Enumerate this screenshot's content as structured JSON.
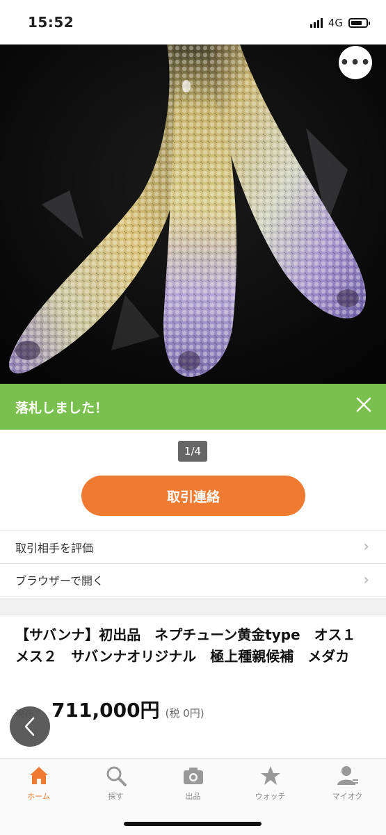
{
  "status": {
    "time": "15:52",
    "network": "4G",
    "battery_level": 0.75
  },
  "banner": {
    "text": "落札しました！"
  },
  "gallery": {
    "indicator": "1/4"
  },
  "contact_button": "取引連絡",
  "menu": [
    {
      "label": "取引相手を評価"
    },
    {
      "label": "ブラウザーで開く"
    }
  ],
  "listing": {
    "title": "【サバンナ】初出品　ネプチューン黄金type　オス１　メス２　サバンナオリジナル　極上種親候補　メダカ",
    "price_label": "現在",
    "price": "711,000円",
    "tax": "(税 0円)"
  },
  "tabs": [
    {
      "label": "ホーム",
      "icon": "home-icon",
      "active": true
    },
    {
      "label": "探す",
      "icon": "search-icon"
    },
    {
      "label": "出品",
      "icon": "camera-icon"
    },
    {
      "label": "ウォッチ",
      "icon": "star-icon"
    },
    {
      "label": "マイオク",
      "icon": "user-icon"
    }
  ],
  "colors": {
    "accent": "#ef7b33",
    "banner": "#7ac04f"
  }
}
